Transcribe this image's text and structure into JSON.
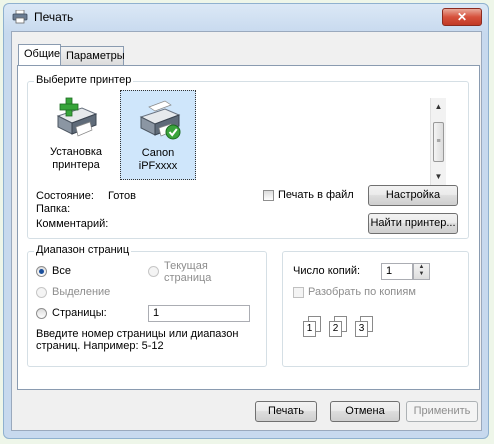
{
  "window": {
    "title": "Печать",
    "close_symbol": "✕"
  },
  "tabs": [
    {
      "label": "Общие",
      "active": true
    },
    {
      "label": "Параметры",
      "active": false
    }
  ],
  "select_printer": {
    "group_label": "Выберите принтер",
    "printers": [
      {
        "label_line1": "Установка",
        "label_line2": "принтера",
        "icon": "add-printer-icon",
        "selected": false
      },
      {
        "label_line1": "Canon",
        "label_line2": "iPFxxxx",
        "icon": "printer-default-icon",
        "selected": true
      }
    ],
    "status_label": "Состояние:",
    "status_value": "Готов",
    "folder_label": "Папка:",
    "folder_value": "",
    "comment_label": "Комментарий:",
    "comment_value": "",
    "print_to_file_label": "Печать в файл",
    "preferences_button": "Настройка",
    "find_printer_button": "Найти принтер..."
  },
  "page_range": {
    "group_label": "Диапазон страниц",
    "all_label": "Все",
    "current_page_line1": "Текущая",
    "current_page_line2": "страница",
    "selection_label": "Выделение",
    "pages_label": "Страницы:",
    "pages_value": "1",
    "hint_line1": "Введите номер страницы или диапазон",
    "hint_line2": "страниц.  Например: 5-12"
  },
  "copies": {
    "label": "Число копий:",
    "value": "1",
    "collate_label": "Разобрать по копиям",
    "collate_pages": [
      "1",
      "2",
      "3"
    ]
  },
  "footer": {
    "print_button": "Печать",
    "cancel_button": "Отмена",
    "apply_button": "Применить"
  }
}
